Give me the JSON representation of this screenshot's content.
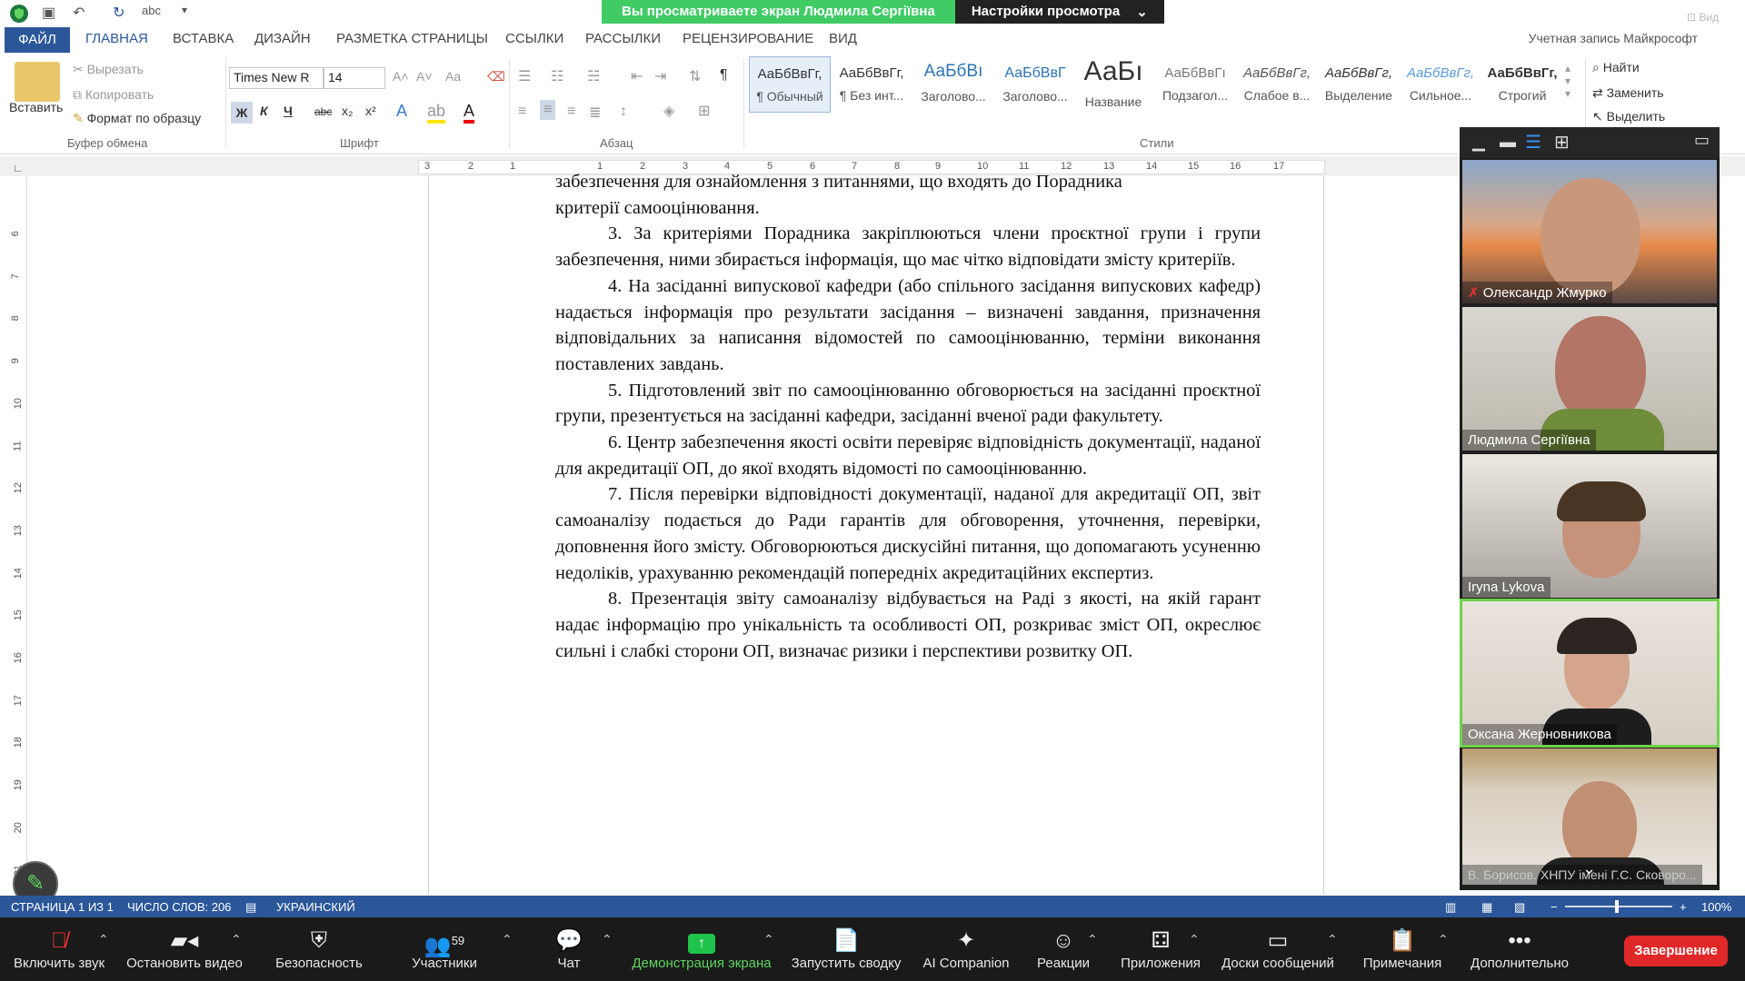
{
  "share_banner": {
    "text": "Вы просматриваете экран Людмила Сергіївна",
    "settings": "Настройки просмотра"
  },
  "ribbon": {
    "tabs": [
      "ФАЙЛ",
      "ГЛАВНАЯ",
      "ВСТАВКА",
      "ДИЗАЙН",
      "РАЗМЕТКА СТРАНИЦЫ",
      "ССЫЛКИ",
      "РАССЫЛКИ",
      "РЕЦЕНЗИРОВАНИЕ",
      "ВИД"
    ],
    "account": "Учетная запись Майкрософт",
    "clipboard": {
      "paste": "Вставить",
      "cut": "Вырезать",
      "copy": "Копировать",
      "format_painter": "Формат по образцу",
      "label": "Буфер обмена"
    },
    "font": {
      "name": "Times New R",
      "size": "14",
      "label": "Шрифт",
      "bold": "Ж",
      "italic": "К",
      "underline": "Ч",
      "strike": "abc",
      "sub": "x₂",
      "sup": "x²",
      "case": "Aa"
    },
    "paragraph_label": "Абзац",
    "styles_label": "Стили",
    "styles": [
      {
        "sample": "АаБбВвГг,",
        "name": "¶ Обычный"
      },
      {
        "sample": "АаБбВвГг,",
        "name": "¶ Без инт..."
      },
      {
        "sample": "АаБбВı",
        "name": "Заголово..."
      },
      {
        "sample": "АаБбВвГ",
        "name": "Заголово..."
      },
      {
        "sample": "АаБı",
        "name": "Название"
      },
      {
        "sample": "АаБбВвГı",
        "name": "Подзагол..."
      },
      {
        "sample": "АаБбВвГг,",
        "name": "Слабое в..."
      },
      {
        "sample": "АаБбВвГг,",
        "name": "Выделение"
      },
      {
        "sample": "АаБбВвГг,",
        "name": "Сильное..."
      },
      {
        "sample": "АаБбВвГг,",
        "name": "Строгий"
      }
    ],
    "editing": {
      "find": "Найти",
      "replace": "Заменить",
      "select": "Выделить"
    }
  },
  "ruler_numbers": [
    "3",
    "2",
    "1",
    "1",
    "2",
    "3",
    "4",
    "5",
    "6",
    "7",
    "8",
    "9",
    "10",
    "11",
    "12",
    "13",
    "14",
    "15",
    "16",
    "17"
  ],
  "vruler_numbers": [
    "6",
    "7",
    "8",
    "9",
    "10",
    "11",
    "12",
    "13",
    "14",
    "15",
    "16",
    "17",
    "18",
    "19",
    "20",
    "21"
  ],
  "document": {
    "lines": [
      {
        "text": "забезпечення для ознайомлення з питаннями, що входять до  Порадника",
        "indent": false
      },
      {
        "text": "критерії самооцінювання.",
        "indent": false
      },
      {
        "text": "3. За критеріями Порадника закріплюються члени проєктної групи і групи забезпечення, ними збирається інформація, що має чітко відповідати змісту критеріїв.",
        "indent": true
      },
      {
        "text": "4. На засіданні випускової кафедри (або спільного засідання випускових кафедр) надається інформація про результати засідання – визначені завдання, призначення відповідальних за написання відомостей по самооцінюванню, терміни виконання поставлених завдань.",
        "indent": true
      },
      {
        "text": "5. Підготовлений звіт по самооцінюванню обговорюється на засіданні проєктної групи, презентується на засіданні кафедри, засіданні вченої ради факультету.",
        "indent": true
      },
      {
        "text": "6. Центр забезпечення якості освіти перевіряє відповідність документації, наданої для акредитації ОП, до якої входять відомості по самооцінюванню.",
        "indent": true
      },
      {
        "text": "7. Після перевірки відповідності документації, наданої для акредитації ОП, звіт самоаналізу подається до Ради гарантів для обговорення, уточнення, перевірки, доповнення його змісту. Обговорюються дискусійні питання,  що допомагають усуненню недоліків, урахуванню рекомендацій попередніх акредитаційних експертиз.",
        "indent": true
      },
      {
        "text": "8. Презентація звіту самоаналізу відбувається на Раді з якості, на якій гарант надає інформацію про унікальність та особливості ОП, розкриває зміст ОП, окреслює сильні і слабкі сторони ОП, визначає ризики і перспективи розвитку ОП.",
        "indent": true
      }
    ]
  },
  "status_bar": {
    "page": "СТРАНИЦА 1 ИЗ 1",
    "words": "ЧИСЛО СЛОВ: 206",
    "language": "УКРАИНСКИЙ",
    "zoom": "100%"
  },
  "participants": [
    {
      "name": "Олександр Жмурко",
      "muted": true
    },
    {
      "name": "Людмила Сергіївна",
      "muted": false
    },
    {
      "name": "Iryna Lykova",
      "muted": false
    },
    {
      "name": "Оксана Жерновникова",
      "muted": false,
      "active": true
    },
    {
      "name": "В. Борисов. ХНПУ імені Г.С. Сковоро...",
      "muted": false
    }
  ],
  "gallery_view_label": "Вид",
  "toolbar": {
    "unmute": "Включить звук",
    "stop_video": "Остановить видео",
    "security": "Безопасность",
    "participants": "Участники",
    "participants_count": "59",
    "chat": "Чат",
    "share": "Демонстрация экрана",
    "summary": "Запустить сводку",
    "ai": "AI Companion",
    "reactions": "Реакции",
    "apps": "Приложения",
    "whiteboards": "Доски сообщений",
    "notes": "Примечания",
    "more": "Дополнительно",
    "end": "Завершение"
  },
  "colors": {
    "word_blue": "#2b579a",
    "share_green": "#1fc24b",
    "active_outline": "#6ed34b",
    "end_red": "#e02828"
  }
}
